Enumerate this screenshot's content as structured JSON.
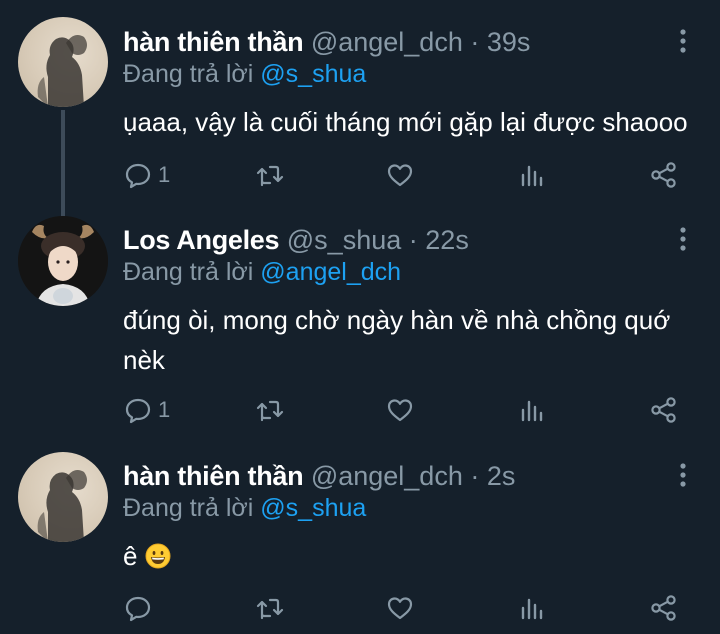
{
  "tweets": [
    {
      "name": "hàn thiên thần",
      "handle": "@angel_dch",
      "separator": "·",
      "time": "39s",
      "reply_prefix": "Đang trả lời",
      "reply_handle": "@s_shua",
      "text": "ụaaa, vậy là cuối tháng mới gặp lại được shaooo",
      "reply_count": "1",
      "avatar_icon": "shadow-avatar-icon"
    },
    {
      "name": "Los Angeles",
      "handle": "@s_shua",
      "separator": "·",
      "time": "22s",
      "reply_prefix": "Đang trả lời",
      "reply_handle": "@angel_dch",
      "text": "đúng òi, mong chờ ngày hàn về nhà chồng quớ nèk",
      "reply_count": "1",
      "avatar_icon": "person-avatar-icon"
    },
    {
      "name": "hàn thiên thần",
      "handle": "@angel_dch",
      "separator": "·",
      "time": "2s",
      "reply_prefix": "Đang trả lời",
      "reply_handle": "@s_shua",
      "text": "ê",
      "emoji": "grinning-face-emoji",
      "reply_count": "",
      "avatar_icon": "shadow-avatar-icon"
    }
  ],
  "colors": {
    "background": "#15202b",
    "text": "#ffffff",
    "secondary": "#8899a6",
    "accent": "#1da1f2",
    "thread_line": "#3d4b59"
  },
  "icons": [
    "reply-icon",
    "retweet-icon",
    "like-icon",
    "stats-icon",
    "share-icon",
    "more-options-icon"
  ]
}
